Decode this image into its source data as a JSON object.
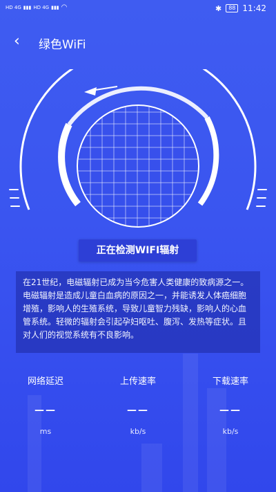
{
  "status_bar": {
    "signal_1": "HD 4G",
    "signal_2": "HD 4G",
    "battery": "88",
    "time": "11:42"
  },
  "header": {
    "title": "绿色WiFi"
  },
  "detect_button": {
    "label": "正在检测WIFI辐射"
  },
  "description": "在21世纪，电磁辐射已成为当今危害人类健康的致病源之一。电磁辐射是造成儿童白血病的原因之一，并能诱发人体癌细胞增殖，影响人的生殖系统，导致儿童智力残缺，影响人的心血管系统。轻微的辐射会引起孕妇呕吐、腹泻、发热等症状。且对人们的视觉系统有不良影响。",
  "stats": [
    {
      "label": "网络延迟",
      "value": "——",
      "unit": "ms"
    },
    {
      "label": "上传速率",
      "value": "——",
      "unit": "kb/s"
    },
    {
      "label": "下载速率",
      "value": "——",
      "unit": "kb/s"
    }
  ]
}
